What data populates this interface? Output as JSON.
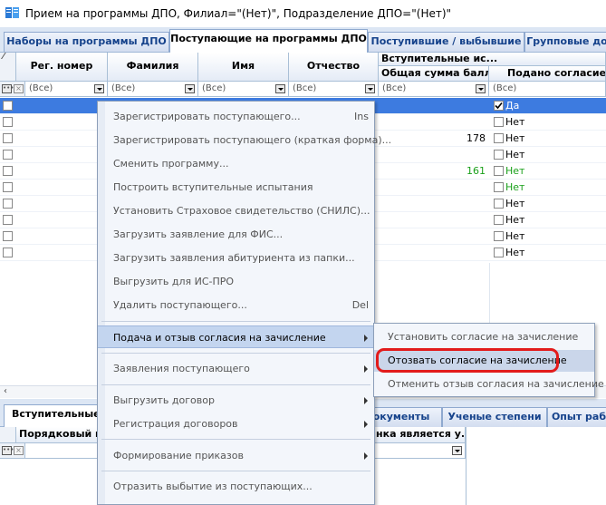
{
  "window": {
    "title": "Прием на программы ДПО, Филиал=\"(Нет)\", Подразделение ДПО=\"(Нет)\""
  },
  "top_tabs": [
    {
      "label": "Наборы на программы ДПО",
      "active": false
    },
    {
      "label": "Поступающие на программы ДПО",
      "active": true
    },
    {
      "label": "Поступившие / выбывшие",
      "active": false
    },
    {
      "label": "Групповые до",
      "active": false
    }
  ],
  "grid": {
    "corner_mark": "⁄",
    "columns": [
      {
        "label": "Рег. номер"
      },
      {
        "label": "Фамилия"
      },
      {
        "label": "Имя"
      },
      {
        "label": "Отчество"
      }
    ],
    "group_header": "Вступительные ис...",
    "sub_column": "Общая сумма балл...",
    "agree_column": "Подано согласие н",
    "filter_value": "(Все)",
    "rows": [
      {
        "selected": true,
        "score": "",
        "agree": "Да",
        "agree_checked": true
      },
      {
        "selected": false,
        "score": "",
        "agree": "Нет",
        "agree_checked": false
      },
      {
        "selected": false,
        "score": "178",
        "score_color": "#000000",
        "agree": "Нет",
        "agree_checked": false
      },
      {
        "selected": false,
        "score": "",
        "agree": "Нет",
        "agree_checked": false
      },
      {
        "selected": false,
        "score": "161",
        "score_color": "#1aa01a",
        "agree": "Нет",
        "agree_checked": false,
        "agree_color": "#1aa01a"
      },
      {
        "selected": false,
        "score": "",
        "agree": "Нет",
        "agree_checked": false,
        "agree_color": "#1aa01a"
      },
      {
        "selected": false,
        "score": "",
        "agree": "Нет",
        "agree_checked": false
      },
      {
        "selected": false,
        "score": "",
        "agree": "Нет",
        "agree_checked": false
      },
      {
        "selected": false,
        "score": "",
        "agree": "Нет",
        "agree_checked": false
      },
      {
        "selected": false,
        "score": "",
        "agree": "Нет",
        "agree_checked": false
      }
    ]
  },
  "bottom_tabs": [
    {
      "label": "Вступительные",
      "active": true
    },
    {
      "label": "окументы",
      "active": false
    },
    {
      "label": "Ученые степени",
      "active": false
    },
    {
      "label": "Опыт раб",
      "active": false
    }
  ],
  "bottom_grid": {
    "col1": "Порядковый но",
    "col2": "нка является у..."
  },
  "context_menu": {
    "items": [
      {
        "label": "Зарегистрировать поступающего...",
        "shortcut": "Ins"
      },
      {
        "label": "Зарегистрировать поступающего (краткая форма)...",
        "shortcut": ""
      },
      {
        "label": "Сменить программу...",
        "shortcut": ""
      },
      {
        "label": "Построить вступительные испытания",
        "shortcut": ""
      },
      {
        "label": "Установить Страховое свидетельство (СНИЛС)...",
        "shortcut": ""
      },
      {
        "label": "Загрузить заявление для ФИС...",
        "shortcut": ""
      },
      {
        "label": "Загрузить заявления абитуриента из папки...",
        "shortcut": ""
      },
      {
        "label": "Выгрузить для ИС-ПРО",
        "shortcut": ""
      },
      {
        "label": "Удалить поступающего...",
        "shortcut": "Del"
      },
      {
        "label": "Подача и отзыв согласия на зачисление",
        "submenu": true,
        "highlighted": true
      },
      {
        "label": "Заявления поступающего",
        "submenu": true
      },
      {
        "label": "Выгрузить договор",
        "submenu": true
      },
      {
        "label": "Регистрация договоров",
        "submenu": true
      },
      {
        "label": "Формирование приказов",
        "submenu": true
      },
      {
        "label": "Отразить выбытие из поступающих...",
        "shortcut": ""
      }
    ]
  },
  "submenu": {
    "items": [
      {
        "label": "Установить согласие на зачисление"
      },
      {
        "label": "Отозвать согласие на зачисление",
        "highlighted": true
      },
      {
        "label": "Отменить отзыв согласия на зачисление"
      }
    ]
  },
  "colors": {
    "selection": "#3d7be0",
    "menu_highlight": "#c3d5ef",
    "annotation_red": "#e21b1b",
    "green_text": "#1aa01a"
  }
}
